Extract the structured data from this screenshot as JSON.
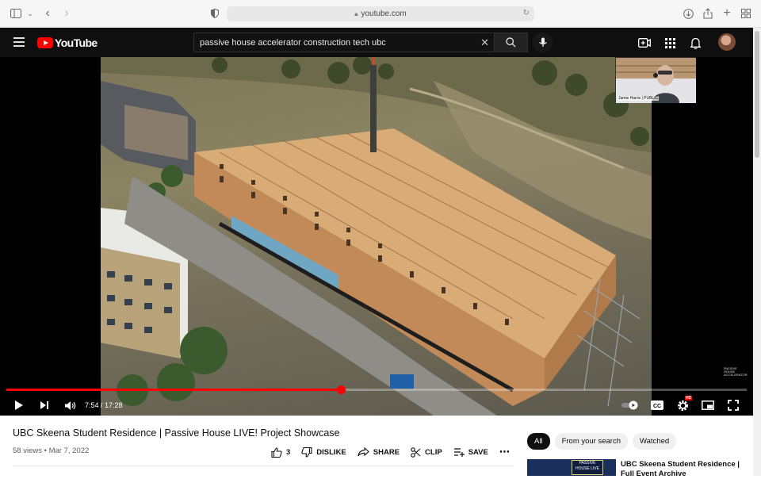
{
  "browser": {
    "url": "youtube.com",
    "icons": [
      "sidebar-icon",
      "chevron-down-icon",
      "back-icon",
      "forward-icon",
      "shield-icon",
      "lock-icon",
      "reload-icon",
      "download-icon",
      "share-icon",
      "new-tab-icon",
      "tab-overview-icon"
    ]
  },
  "header": {
    "logo_text": "YouTube",
    "search_value": "passive house accelerator construction tech ubc",
    "icons": [
      "menu-icon",
      "search-icon",
      "mic-icon",
      "create-icon",
      "apps-icon",
      "bell-icon",
      "avatar"
    ],
    "brand_color": "#ff0000"
  },
  "player": {
    "current_time": "7:54",
    "duration": "17:28",
    "time_display": "7:54 / 17:28",
    "progress_fraction": 0.452,
    "webcam_caption": "Jamie Harris | PUBLIC",
    "watermark": "PASSIVE HOUSE ACCELERATOR",
    "hd_badge": "HD",
    "icons": [
      "play-icon",
      "next-icon",
      "volume-icon",
      "autoplay-toggle",
      "cc-icon",
      "settings-icon",
      "miniplayer-icon",
      "fullscreen-icon"
    ]
  },
  "video": {
    "title": "UBC Skeena Student Residence | Passive House LIVE! Project Showcase",
    "views": "58 views",
    "date": "Mar 7, 2022",
    "meta": "58 views • Mar 7, 2022",
    "likes": "3",
    "dislike_label": "DISLIKE",
    "share_label": "SHARE",
    "clip_label": "CLIP",
    "save_label": "SAVE",
    "more_label": "⋯"
  },
  "sidebar": {
    "chips": [
      "All",
      "From your search",
      "Watched"
    ],
    "recommendation": {
      "title": "UBC Skeena Student Residence | Full Event Archive",
      "thumb_text": "PASSIVE HOUSE LIVE"
    }
  }
}
